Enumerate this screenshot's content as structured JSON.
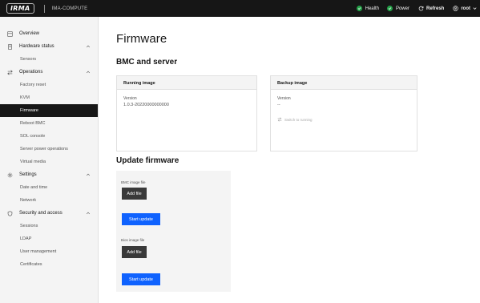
{
  "topbar": {
    "logo_text": "IRMA",
    "host": "IMA-COMPUTE",
    "health_label": "Health",
    "power_label": "Power",
    "refresh_label": "Refresh",
    "user_label": "root"
  },
  "colors": {
    "topbar_bg": "#161616",
    "sidebar_bg": "#f4f4f4",
    "status_ok": "#24a148",
    "primary": "#0f62fe",
    "secondary_btn": "#393939"
  },
  "sidebar": {
    "overview": "Overview",
    "hardware_status": {
      "label": "Hardware status",
      "items": [
        "Sensors"
      ]
    },
    "operations": {
      "label": "Operations",
      "items": [
        "Factory reset",
        "KVM",
        "Firmware",
        "Reboot BMC",
        "SOL console",
        "Server power operations",
        "Virtual media"
      ],
      "active": "Firmware"
    },
    "settings": {
      "label": "Settings",
      "items": [
        "Date and time",
        "Network"
      ]
    },
    "security": {
      "label": "Security and access",
      "items": [
        "Sessions",
        "LDAP",
        "User management",
        "Certificates"
      ]
    }
  },
  "main": {
    "title": "Firmware",
    "bmc_section": "BMC and server",
    "running": {
      "header": "Running image",
      "version_label": "Version",
      "version_value": "1.0.3-20220000000000"
    },
    "backup": {
      "header": "Backup image",
      "version_label": "Version",
      "version_value": "--",
      "switch_label": "Switch to running"
    },
    "update_section": "Update firmware",
    "bmc_file_label": "BMC image file",
    "bios_file_label": "Bios image file",
    "add_file_label": "Add file",
    "start_update_label": "Start update"
  }
}
